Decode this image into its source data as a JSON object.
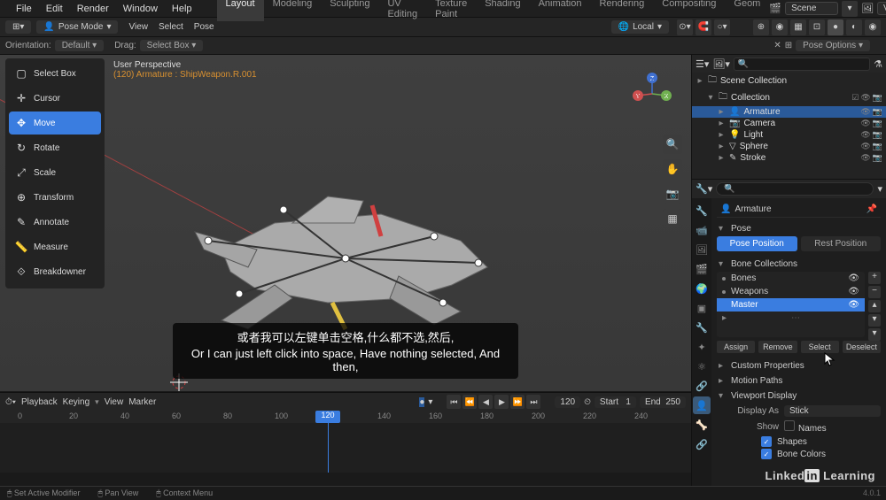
{
  "topbar": {
    "menus": [
      "File",
      "Edit",
      "Render",
      "Window",
      "Help"
    ],
    "workspaces": [
      "Layout",
      "Modeling",
      "Sculpting",
      "UV Editing",
      "Texture Paint",
      "Shading",
      "Animation",
      "Rendering",
      "Compositing",
      "Geom"
    ],
    "active_workspace": "Layout",
    "scene_label": "Scene",
    "viewlayer_label": "ViewLayer"
  },
  "toolbar2": {
    "mode": "Pose Mode",
    "menus": [
      "View",
      "Select",
      "Pose"
    ],
    "orientation": "Local"
  },
  "toolbar3": {
    "orientation_label": "Orientation:",
    "orientation_value": "Default",
    "drag_label": "Drag:",
    "drag_value": "Select Box",
    "pose_options": "Pose Options"
  },
  "tools": [
    {
      "name": "Select Box",
      "icon": "▢"
    },
    {
      "name": "Cursor",
      "icon": "✛"
    },
    {
      "name": "Move",
      "icon": "✥"
    },
    {
      "name": "Rotate",
      "icon": "↻"
    },
    {
      "name": "Scale",
      "icon": "⤢"
    },
    {
      "name": "Transform",
      "icon": "⊕"
    },
    {
      "name": "Annotate",
      "icon": "✎"
    },
    {
      "name": "Measure",
      "icon": "📏"
    },
    {
      "name": "Breakdowner",
      "icon": "⟐"
    }
  ],
  "active_tool": "Move",
  "viewport": {
    "perspective": "User Perspective",
    "context": "(120) Armature : ShipWeapon.R.001"
  },
  "outliner": {
    "root": "Scene Collection",
    "items": [
      {
        "name": "Collection",
        "indent": 1,
        "expanded": true
      },
      {
        "name": "Armature",
        "indent": 2,
        "selected": true
      },
      {
        "name": "Camera",
        "indent": 2
      },
      {
        "name": "Light",
        "indent": 2
      },
      {
        "name": "Sphere",
        "indent": 2
      },
      {
        "name": "Stroke",
        "indent": 2
      }
    ]
  },
  "properties": {
    "breadcrumb": "Armature",
    "pose_section": "Pose",
    "pose_position": "Pose Position",
    "rest_position": "Rest Position",
    "bone_collections_header": "Bone Collections",
    "bone_collections": [
      {
        "name": "Bones"
      },
      {
        "name": "Weapons"
      },
      {
        "name": "Master",
        "selected": true
      }
    ],
    "bc_buttons": [
      "Assign",
      "Remove",
      "Select",
      "Deselect"
    ],
    "custom_props": "Custom Properties",
    "motion_paths": "Motion Paths",
    "viewport_display": "Viewport Display",
    "display_as_label": "Display As",
    "display_as_value": "Stick",
    "show_label": "Show",
    "show_names": "Names",
    "show_shapes": "Shapes",
    "show_bone_colors": "Bone Colors"
  },
  "timeline": {
    "menus": [
      "Playback",
      "Keying",
      "View",
      "Marker"
    ],
    "current_frame": 120,
    "start_label": "Start",
    "start": 1,
    "end_label": "End",
    "end": 250,
    "ticks": [
      0,
      20,
      40,
      60,
      80,
      100,
      120,
      140,
      160,
      180,
      200,
      220,
      240
    ]
  },
  "statusbar": {
    "left": "Set Active Modifier",
    "pan": "Pan View",
    "context": "Context Menu"
  },
  "subtitle": {
    "zh": "或者我可以左键单击空格,什么都不选,然后,",
    "en": "Or I can just left click into space, Have nothing selected, And then,"
  },
  "watermark": "Linked    Learning",
  "watermark_in": "in",
  "version": "4.0.1"
}
